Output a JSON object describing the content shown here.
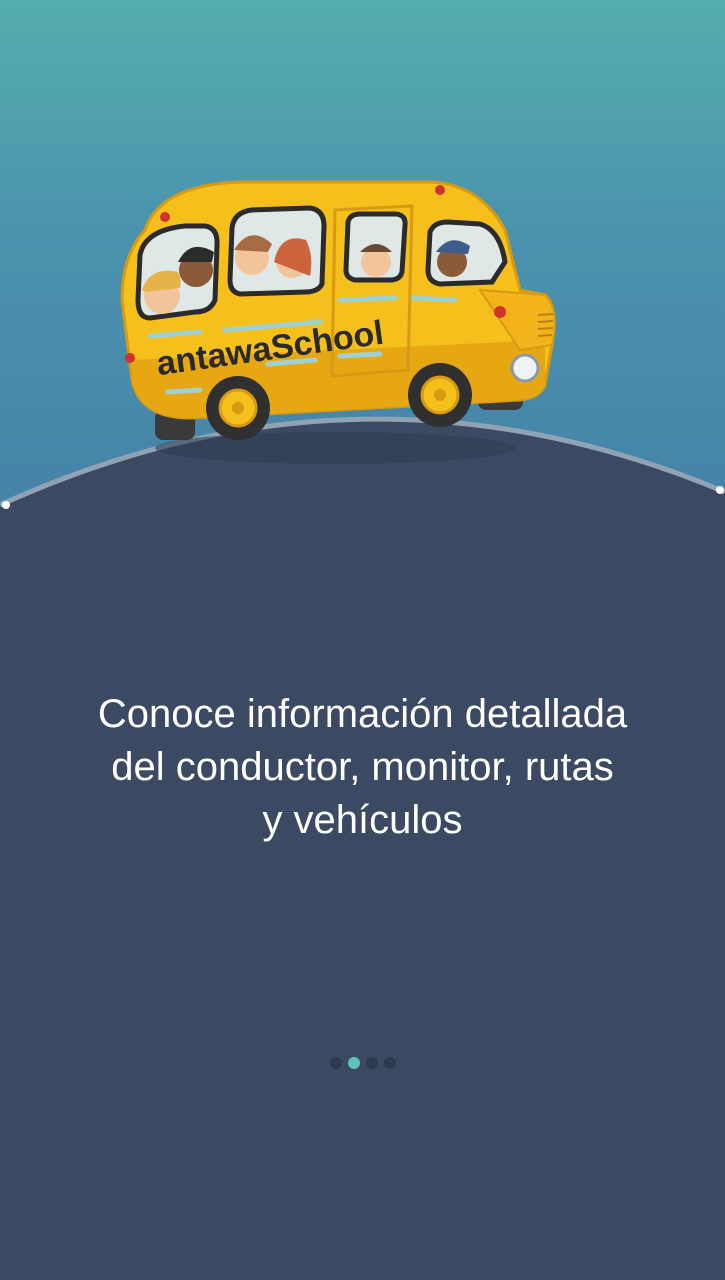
{
  "onboarding": {
    "bus_label": "antawaSchool",
    "message_lines": [
      "Conoce información detallada",
      "del conductor, monitor, rutas",
      "y vehículos"
    ],
    "pager": {
      "total": 4,
      "current": 2
    }
  },
  "colors": {
    "sky_top": "#55adad",
    "sky_bottom": "#4582a8",
    "ground": "#3b4a62",
    "bus_yellow": "#f5bf1c",
    "indicator_active": "#5fc2b8",
    "indicator_inactive": "#2c3a50",
    "text": "#ffffff"
  }
}
